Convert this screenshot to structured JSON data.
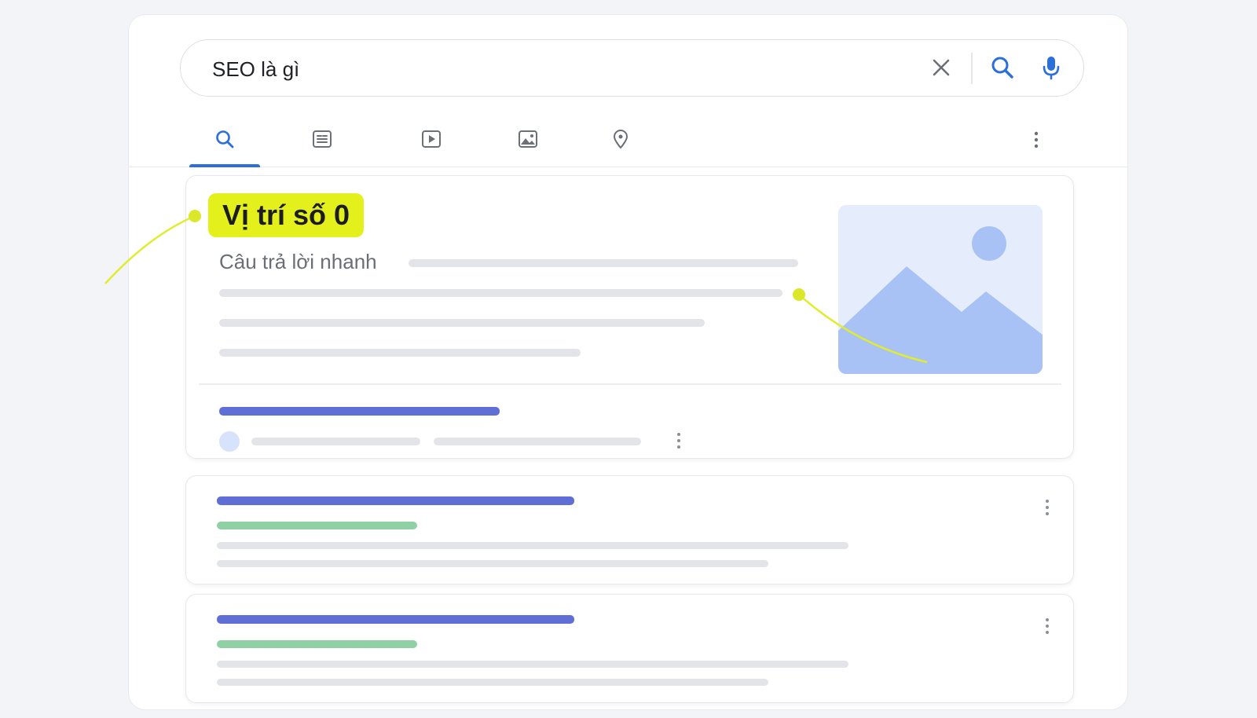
{
  "search": {
    "query": "SEO là gì",
    "icons": [
      "clear-icon",
      "search-icon",
      "microphone-icon"
    ]
  },
  "tabs": [
    {
      "name": "all",
      "icon": "search-icon",
      "active": true
    },
    {
      "name": "news",
      "icon": "news-icon",
      "active": false
    },
    {
      "name": "videos",
      "icon": "video-icon",
      "active": false
    },
    {
      "name": "images",
      "icon": "image-icon",
      "active": false
    },
    {
      "name": "maps",
      "icon": "map-pin-icon",
      "active": false
    }
  ],
  "featured_snippet": {
    "badge": "Vị trí số 0",
    "quick_answer_label": "Câu trả lời nhanh",
    "thumbnail_icon": "image-placeholder-icon"
  },
  "colors": {
    "accent": "#2a6fdb",
    "highlight": "#e4f01c",
    "result_title": "#5f6fd6",
    "result_url": "#8fd1a5",
    "placeholder_text": "#e3e4e8",
    "image_placeholder": "#a9c2f5"
  }
}
